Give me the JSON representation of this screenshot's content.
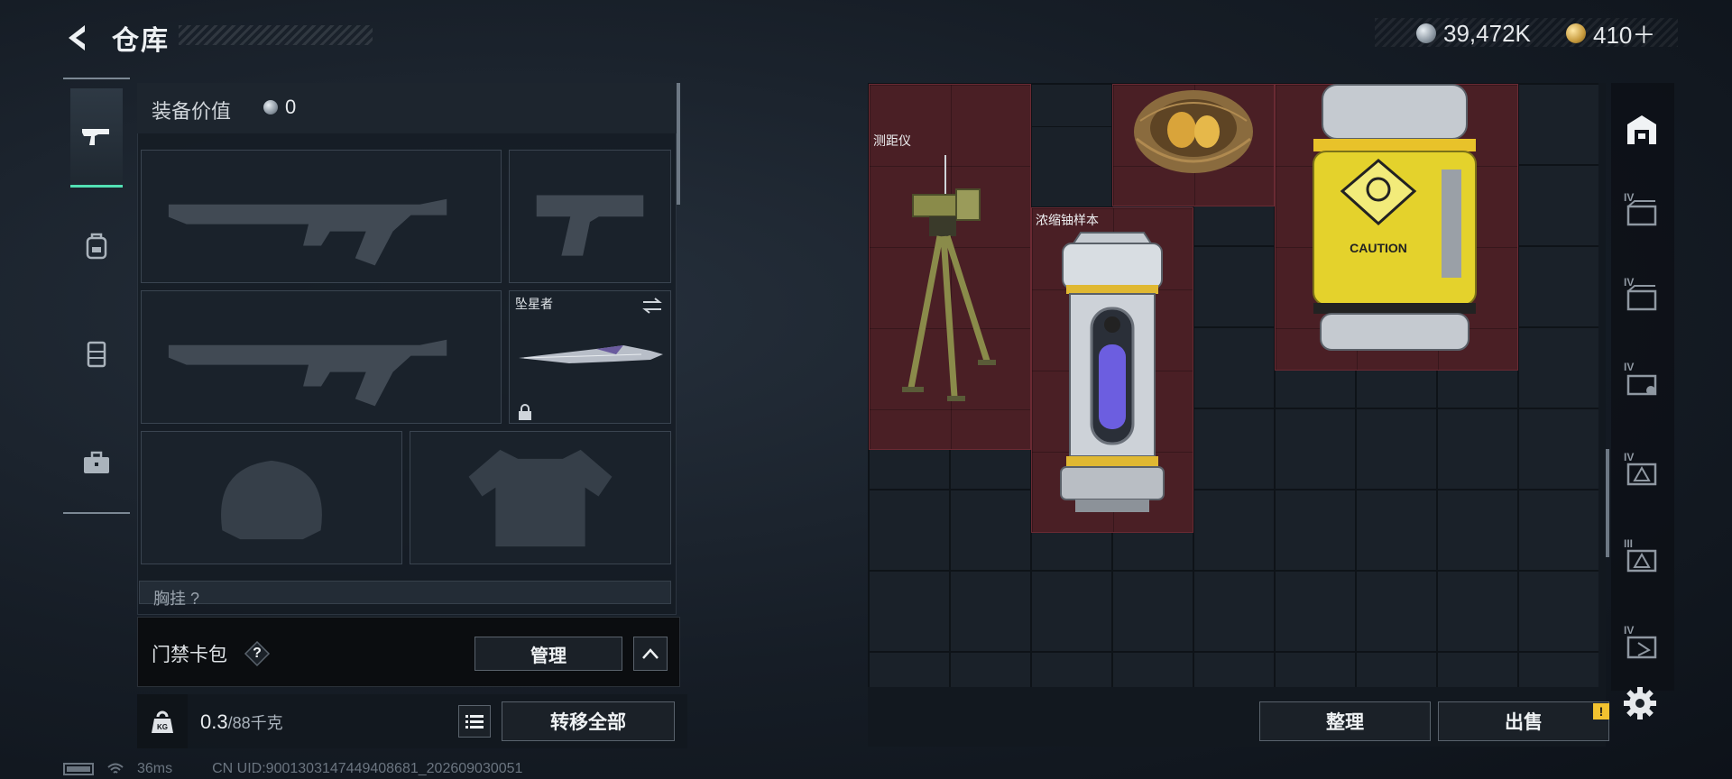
{
  "header": {
    "title": "仓库",
    "currency": [
      {
        "icon": "silver-coin-icon",
        "value": "39,472K"
      },
      {
        "icon": "gold-coin-icon",
        "value": "410＋"
      }
    ]
  },
  "side_tabs": [
    {
      "icon": "gun-icon",
      "active": true
    },
    {
      "icon": "backpack-icon",
      "active": false
    },
    {
      "icon": "vest-icon",
      "active": false
    },
    {
      "icon": "briefcase-icon",
      "active": false
    }
  ],
  "equipment": {
    "value_label": "装备价值",
    "value": "0",
    "melee_name": "坠星者",
    "cut_row_label": "胸挂",
    "cut_row_value": "?"
  },
  "keycard": {
    "label": "门禁卡包",
    "help": "?",
    "manage": "管理"
  },
  "weight": {
    "current": "0.3",
    "capacity": "/88千克",
    "transfer_all": "转移全部"
  },
  "status": {
    "ping": "36ms",
    "uid": "CN UID:9001303147449408681_202609030051"
  },
  "storage_items": [
    {
      "label": "测距仪"
    },
    {
      "label": "浓缩铀样本"
    }
  ],
  "rail_tiers": [
    "IV",
    "IV",
    "IV",
    "IV",
    "III",
    "IV"
  ],
  "actions": {
    "organize": "整理",
    "sell": "出售",
    "sell_badge": "!"
  },
  "colors": {
    "accent": "#52e0b4",
    "item_highlight": "#4a1f25",
    "warning": "#f2c230"
  }
}
